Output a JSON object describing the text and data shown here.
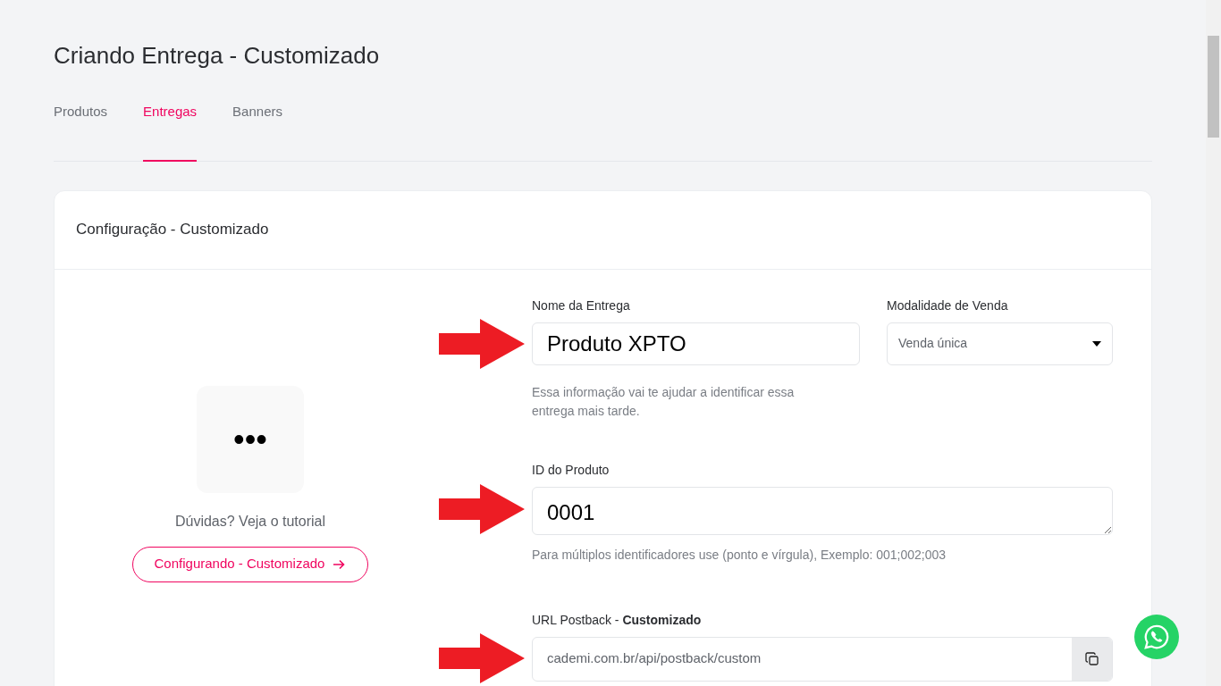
{
  "page_title": "Criando Entrega - Customizado",
  "tabs": [
    {
      "label": "Produtos",
      "selected": false
    },
    {
      "label": "Entregas",
      "selected": true
    },
    {
      "label": "Banners",
      "selected": false
    }
  ],
  "card": {
    "title": "Configuração - Customizado",
    "tutorial": {
      "icon_text": "•••",
      "caption": "Dúvidas? Veja o tutorial",
      "button": "Configurando - Customizado"
    },
    "fields": {
      "name": {
        "label": "Nome da Entrega",
        "value": "Produto XPTO",
        "help": "Essa informação vai te ajudar a identificar essa entrega mais tarde."
      },
      "mode": {
        "label": "Modalidade de Venda",
        "value": "Venda única"
      },
      "product_id": {
        "label": "ID do Produto",
        "value": "0001",
        "help": "Para múltiplos identificadores use (ponto e vírgula), Exemplo: 001;002;003"
      },
      "postback": {
        "label": "URL Postback - **Customizado**",
        "value": "cademi.com.br/api/postback/custom"
      }
    }
  }
}
